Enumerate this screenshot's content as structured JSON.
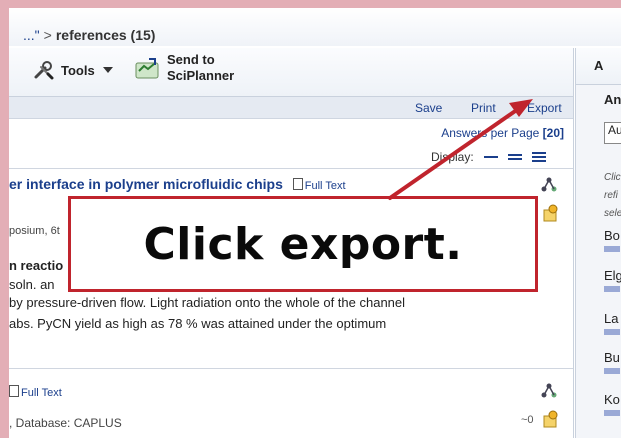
{
  "breadcrumb": {
    "prev": "...\"",
    "separator": ">",
    "current": "references (15)"
  },
  "toolbar": {
    "tools_label": "Tools",
    "send_label_line1": "Send to",
    "send_label_line2": "SciPlanner"
  },
  "actions": {
    "save": "Save",
    "print": "Print",
    "export": "Export"
  },
  "answers_per_page": {
    "label": "Answers per Page",
    "value": "[20]"
  },
  "display": {
    "label": "Display:"
  },
  "results": [
    {
      "title": "er interface in polymer microfluidic chips",
      "full_text": "Full Text",
      "meta": "posium, 6t",
      "line1": "n reactio",
      "line2": "soln. an",
      "line3": "by pressure-driven flow.  Light radiation onto the whole of the channel",
      "line4": "abs.  PyCN yield as high as 78 % was attained under the optimum"
    },
    {
      "full_text": "Full Text",
      "meta": ", Database: CAPLUS",
      "score": "~0"
    }
  ],
  "right_panel": {
    "header": "A",
    "label": "An",
    "select_value": "Au",
    "note_lines": [
      "Clic",
      "refi",
      "sele"
    ],
    "items": [
      "Bo",
      "Elg",
      "La",
      "Bu",
      "Ko"
    ]
  },
  "callout": {
    "text": "Click export."
  },
  "colors": {
    "link": "#1b3f8c",
    "callout_border": "#c0242d",
    "arrow": "#c0242d",
    "frame": "#e3aeb6"
  }
}
